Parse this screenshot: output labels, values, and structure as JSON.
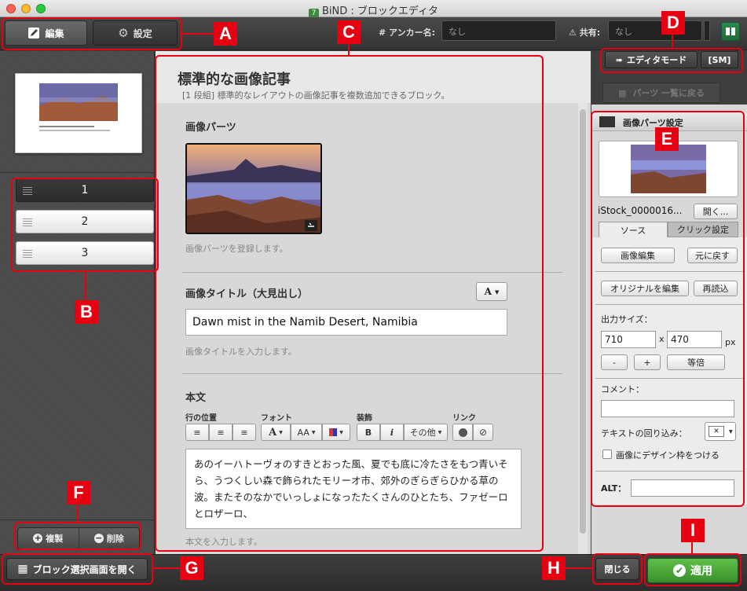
{
  "window": {
    "title": "BiND : ブロックエディタ",
    "app_icon": "7"
  },
  "toolbar": {
    "edit_label": "編集",
    "settings_label": "設定",
    "anchor_label": "# アンカー名:",
    "anchor_value": "なし",
    "share_label": "共有:",
    "share_value": "なし"
  },
  "right_toolbar": {
    "editor_mode_label": "エディタモード",
    "sm_label": "[SM]",
    "back_to_parts_label": "パーツ 一覧に戻る"
  },
  "left_panel": {
    "blocks": [
      "1",
      "2",
      "3"
    ],
    "duplicate_label": "複製",
    "delete_label": "削除"
  },
  "main": {
    "title": "標準的な画像記事",
    "subtitle": "[1 段組] 標準的なレイアウトの画像記事を複数追加できるブロック。",
    "image_parts_title": "画像パーツ",
    "image_parts_hint": "画像パーツを登録します。",
    "image_title_heading": "画像タイトル（大見出し）",
    "image_title_value": "Dawn mist in the Namib Desert, Namibia",
    "image_title_hint": "画像タイトルを入力します。",
    "body_heading": "本文",
    "format_groups": {
      "line_position": "行の位置",
      "font": "フォント",
      "decoration": "装飾",
      "link": "リンク"
    },
    "format_buttons": {
      "bold": "B",
      "italic": "i",
      "other": "その他",
      "font_a": "A",
      "font_aa": "AA"
    },
    "body_text": "あのイーハトーヴォのすきとおった風、夏でも底に冷たさをもつ青いそら、うつくしい森で飾られたモリーオ市、郊外のぎらぎらひかる草の波。またそのなかでいっしょになったたくさんのひとたち、ファゼーロとロザーロ、",
    "body_hint": "本文を入力します。",
    "style_button": "A"
  },
  "image_settings": {
    "panel_title": "画像パーツ設定",
    "filename": "iStock_0000016...",
    "open_label": "開く...",
    "tab_source": "ソース",
    "tab_click": "クリック設定",
    "edit_image_label": "画像編集",
    "revert_label": "元に戻す",
    "edit_original_label": "オリジナルを編集",
    "reload_label": "再読込",
    "output_size_label": "出力サイズ：",
    "width": "710",
    "height": "470",
    "times": "x",
    "unit": "px",
    "minus_label": "-",
    "plus_label": "+",
    "same_size_label": "等倍",
    "comment_label": "コメント：",
    "comment_value": "",
    "text_wrap_label": "テキストの回り込み：",
    "design_frame_label": "画像にデザイン枠をつける",
    "alt_label": "ALT：",
    "alt_value": ""
  },
  "bottom": {
    "open_block_select_label": "ブロック選択画面を開く",
    "close_label": "閉じる",
    "apply_label": "適用"
  },
  "annotations": [
    "A",
    "B",
    "C",
    "D",
    "E",
    "F",
    "G",
    "H",
    "I"
  ],
  "colors": {
    "annotation": "#e60012",
    "apply_green": "#3f9a2f",
    "dark_chrome": "#3a3a3a"
  }
}
